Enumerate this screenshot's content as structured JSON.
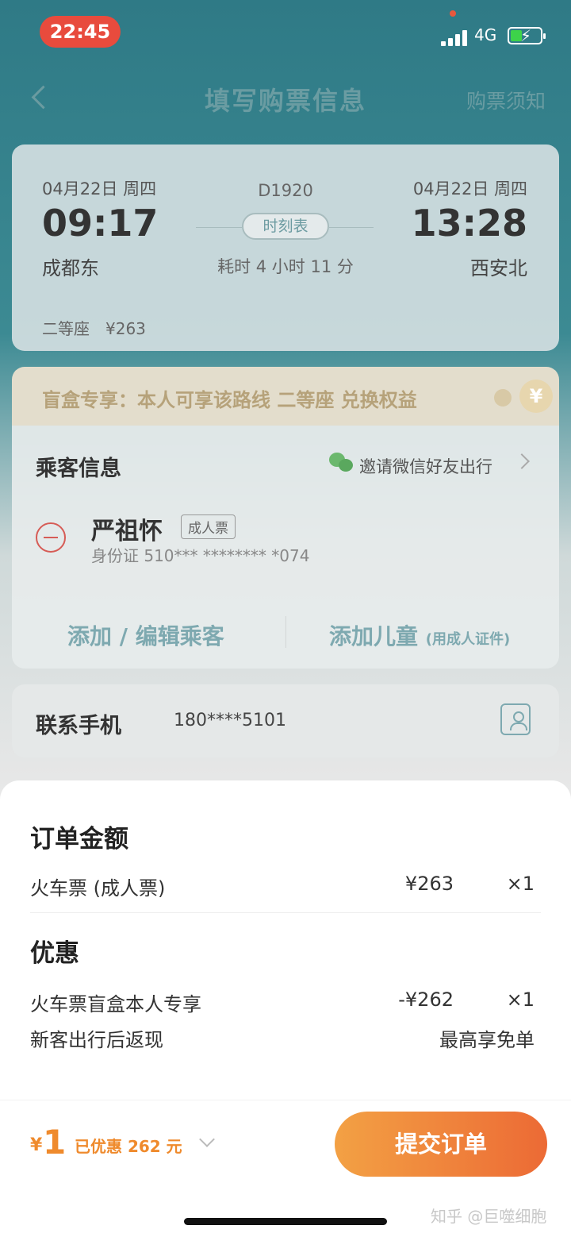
{
  "status": {
    "time": "22:45",
    "network": "4G"
  },
  "nav": {
    "title": "填写购票信息",
    "notice": "购票须知"
  },
  "train": {
    "depart_date": "04月22日 周四",
    "depart_time": "09:17",
    "depart_station": "成都东",
    "train_no": "D1920",
    "timetable_label": "时刻表",
    "duration": "耗时 4 小时 11 分",
    "arrive_date": "04月22日 周四",
    "arrive_time": "13:28",
    "arrive_station": "西安北",
    "seat": "二等座　¥263"
  },
  "promo": {
    "text": "盲盒专享：本人可享该路线 二等座 兑换权益",
    "coin_symbol": "¥"
  },
  "passenger": {
    "title": "乘客信息",
    "invite": "邀请微信好友出行",
    "name": "严祖怀",
    "ticket_type": "成人票",
    "id": "身份证 510*** ******** *074",
    "add_edit": "添加 / 编辑乘客",
    "add_child": "添加儿童",
    "add_child_note": "(用成人证件)"
  },
  "contact": {
    "label": "联系手机",
    "value": "180****5101"
  },
  "sheet": {
    "order_title": "订单金额",
    "ticket_label": "火车票 (成人票)",
    "ticket_price": "¥263",
    "ticket_qty": "×1",
    "discount_title": "优惠",
    "discount_label": "火车票盲盒本人专享",
    "discount_price": "-¥262",
    "discount_qty": "×1",
    "cashback_label": "新客出行后返现",
    "cashback_value": "最高享免单"
  },
  "footer": {
    "yen": "¥",
    "total": "1",
    "saved": "已优惠 262 元",
    "submit": "提交订单",
    "watermark": "知乎 @巨噬细胞"
  }
}
